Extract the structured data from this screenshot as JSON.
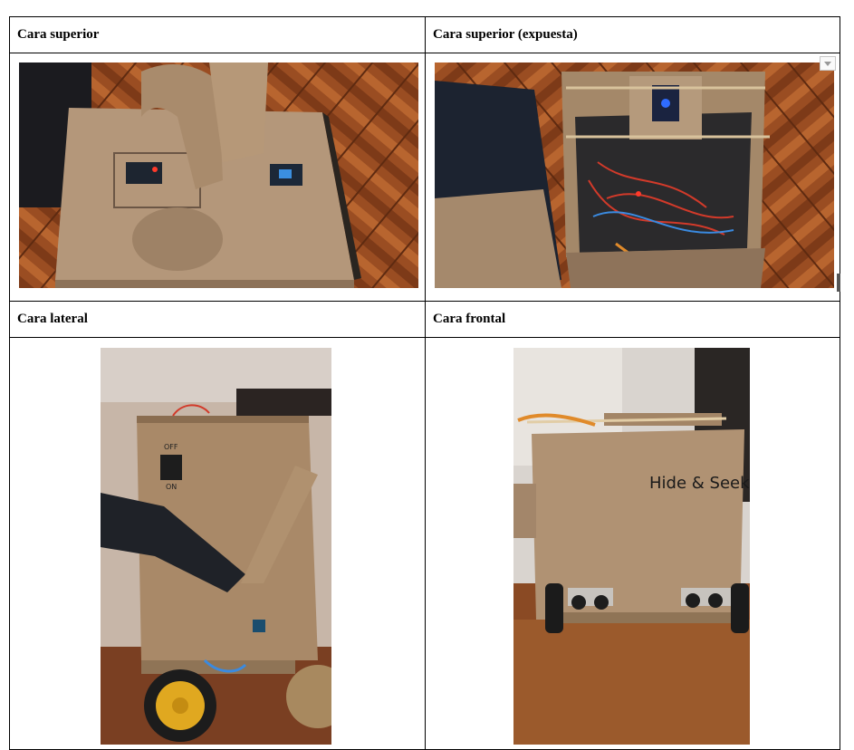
{
  "table": {
    "cells": [
      {
        "id": "top",
        "header": "Cara superior"
      },
      {
        "id": "top-exposed",
        "header": "Cara superior (expuesta)"
      },
      {
        "id": "side",
        "header": "Cara lateral"
      },
      {
        "id": "front",
        "header": "Cara frontal"
      }
    ]
  },
  "photos": {
    "side_switch_off": "OFF",
    "side_switch_on": "ON",
    "front_label": "Hide & Seek"
  },
  "icons": {
    "cell_menu": "chevron-down-icon"
  }
}
